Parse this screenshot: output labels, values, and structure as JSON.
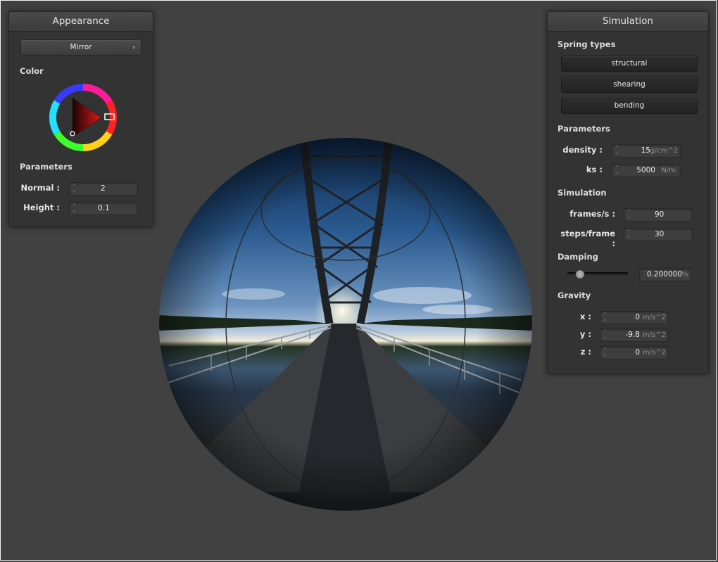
{
  "appearance": {
    "title": "Appearance",
    "shader_button": "Mirror",
    "chevron": "›",
    "color_label": "Color",
    "color_value": "#cc2222",
    "params_label": "Parameters",
    "normal_label": "Normal :",
    "normal_value": "2",
    "height_label": "Height :",
    "height_value": "0.1"
  },
  "simulation": {
    "title": "Simulation",
    "spring_types_label": "Spring types",
    "structural": "structural",
    "shearing": "shearing",
    "bending": "bending",
    "params_label": "Parameters",
    "density_label": "density :",
    "density_value": "15",
    "density_unit": "g/cm^2",
    "ks_label": "ks :",
    "ks_value": "5000",
    "ks_unit": "N/m",
    "sim_label": "Simulation",
    "fps_label": "frames/s :",
    "fps_value": "90",
    "steps_label": "steps/frame :",
    "steps_value": "30",
    "damping_label": "Damping",
    "damping_slider_fraction": 0.2,
    "damping_value": "0.200000",
    "damping_unit": "%",
    "gravity_label": "Gravity",
    "gx_label": "x :",
    "gx_value": "0",
    "gy_label": "y :",
    "gy_value": "-9.8",
    "gz_label": "z :",
    "gz_value": "0",
    "gravity_unit": "m/s^2"
  },
  "icons": {
    "spinner": "spinner-icon",
    "color_wheel": "color-wheel-icon",
    "mirror_sphere": "mirror-sphere-render"
  }
}
